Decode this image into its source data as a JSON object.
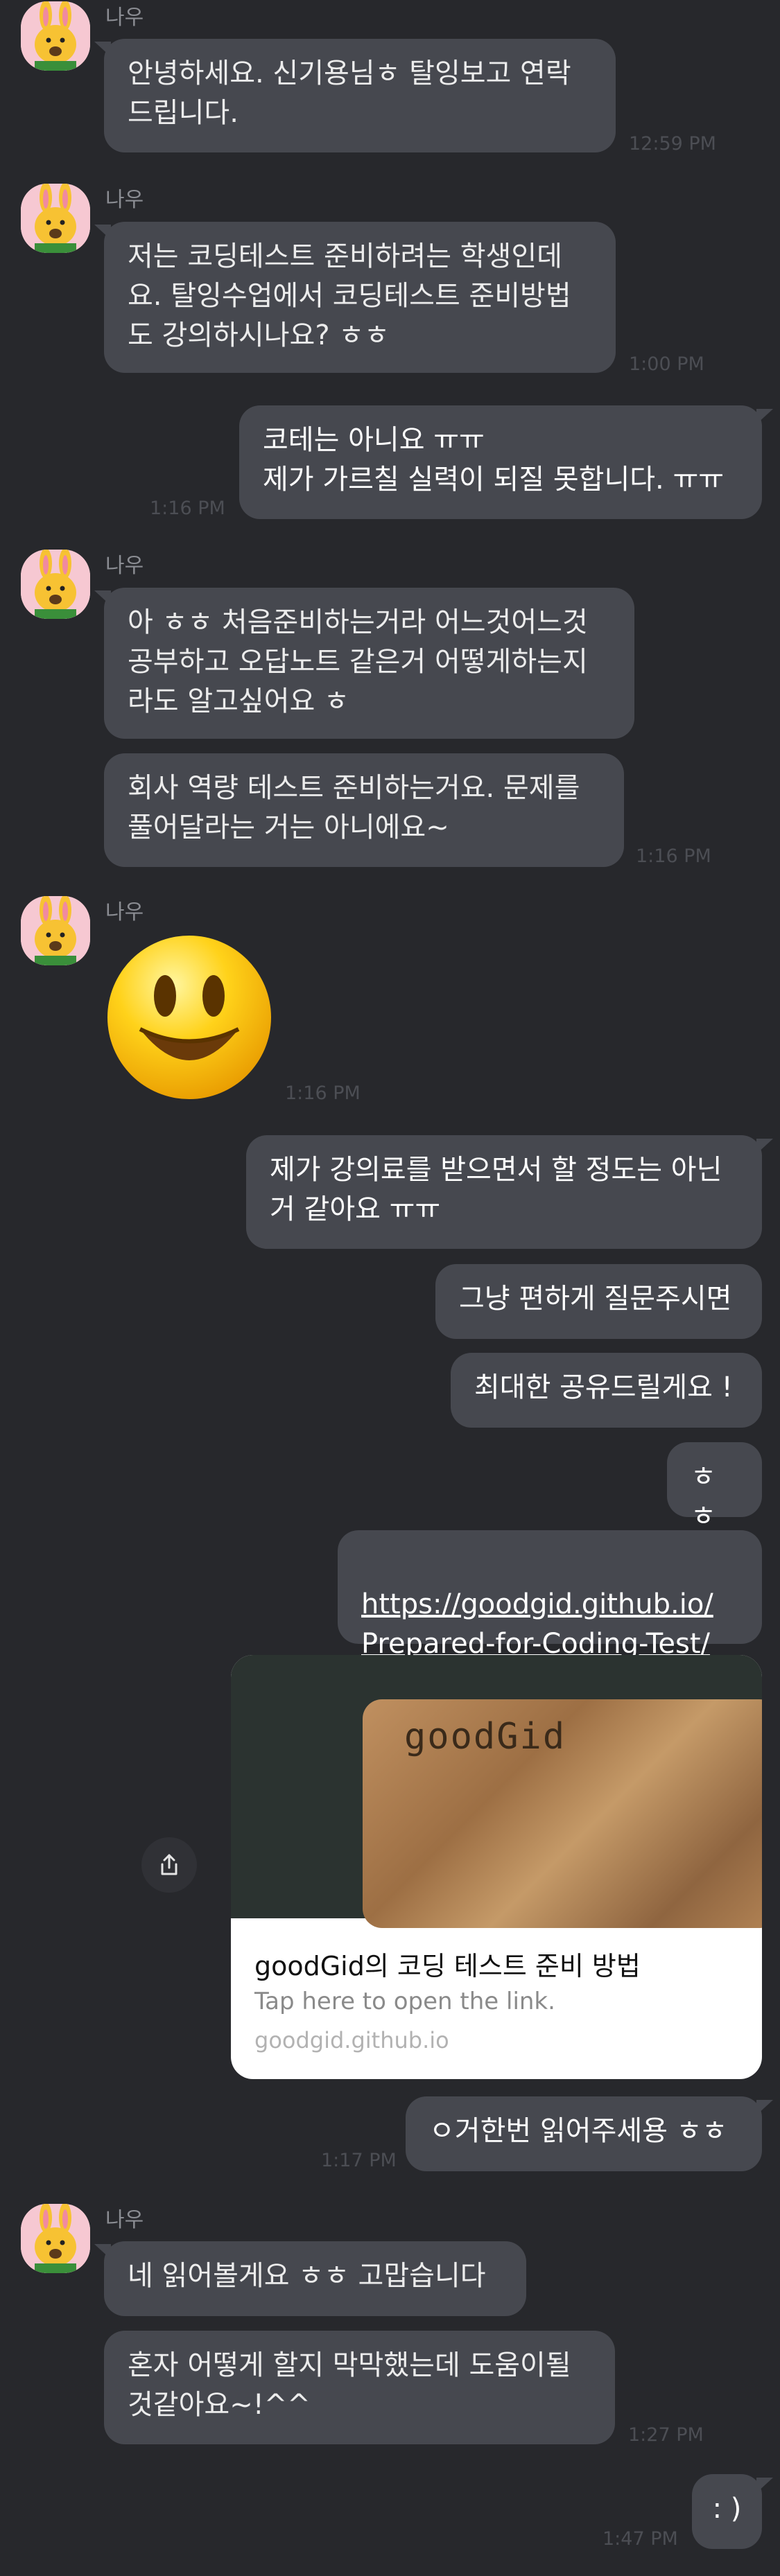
{
  "sender_name": "나우",
  "messages": [
    {
      "text": "안녕하세요. 신기용님ㅎ 탈잉보고 연락\n드립니다.",
      "time": "12:59 PM"
    },
    {
      "text": "저는 코딩테스트 준비하려는 학생인데\n요. 탈잉수업에서 코딩테스트 준비방법\n도 강의하시나요? ㅎㅎ",
      "time": "1:00 PM"
    },
    {
      "text": "코테는 아니요 ㅠㅠ\n제가 가르칠 실력이 되질 못합니다. ㅠㅠ",
      "time": "1:16 PM"
    },
    {
      "text": "아 ㅎㅎ 처음준비하는거라 어느것어느것\n공부하고 오답노트 같은거 어떻게하는지\n라도 알고싶어요 ㅎ"
    },
    {
      "text": "회사 역량 테스트 준비하는거요. 문제를\n풀어달라는 거는 아니에요~",
      "time": "1:16 PM"
    },
    {
      "emoji": "smiley-face",
      "time": "1:16 PM"
    },
    {
      "text": "제가 강의료를 받으면서 할 정도는 아닌\n거 같아요 ㅠㅠ"
    },
    {
      "text": "그냥 편하게 질문주시면"
    },
    {
      "text": "최대한 공유드릴게요 !"
    },
    {
      "text": "ㅎㅎ"
    },
    {
      "text": "https://goodgid.github.io/\nPrepared-for-Coding-Test/"
    },
    {
      "text": "ㅇ거한번 읽어주세용 ㅎㅎ",
      "time": "1:17 PM"
    },
    {
      "text": "네 읽어볼게요 ㅎㅎ 고맙습니다"
    },
    {
      "text": "혼자 어떻게 할지 막막했는데 도움이될\n것같아요~!^^",
      "time": "1:27 PM"
    },
    {
      "text": ": )",
      "time": "1:47 PM"
    }
  ],
  "link_preview": {
    "image_text": "goodGid",
    "title": "goodGid의 코딩 테스트 준비 방법",
    "subtitle": "Tap here to open the link.",
    "domain": "goodgid.github.io",
    "share_icon": "share-icon"
  },
  "colors": {
    "background": "#27282c",
    "bubble": "#46484f",
    "avatar_bg": "#f6c8d2",
    "muni_yellow": "#f7c233"
  }
}
